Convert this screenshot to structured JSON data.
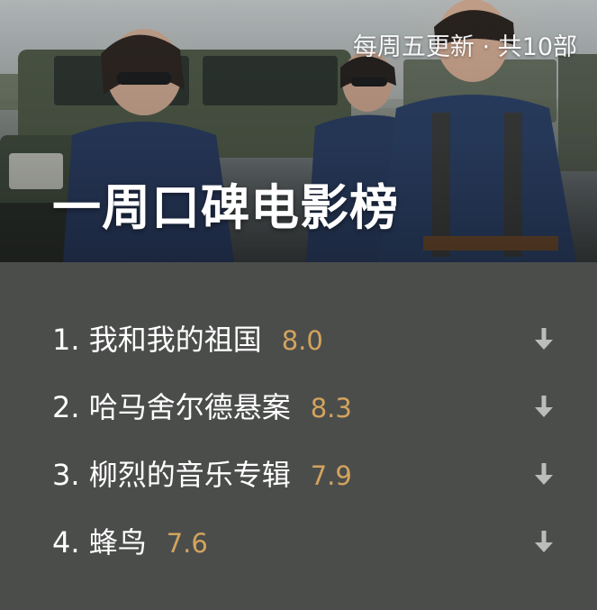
{
  "hero": {
    "update_label": "每周五更新 · 共10部",
    "title": "一周口碑电影榜"
  },
  "colors": {
    "background": "#4b4d4b",
    "score": "#d3a35d",
    "arrow": "#bcbcbc"
  },
  "rankings": [
    {
      "label": "1. 我和我的祖国",
      "score": "8.0",
      "icon": "arrow-down-icon"
    },
    {
      "label": "2. 哈马舍尔德悬案",
      "score": "8.3",
      "icon": "arrow-down-icon"
    },
    {
      "label": "3. 柳烈的音乐专辑",
      "score": "7.9",
      "icon": "arrow-down-icon"
    },
    {
      "label": "4. 蜂鸟",
      "score": "7.6",
      "icon": "arrow-down-icon"
    }
  ]
}
